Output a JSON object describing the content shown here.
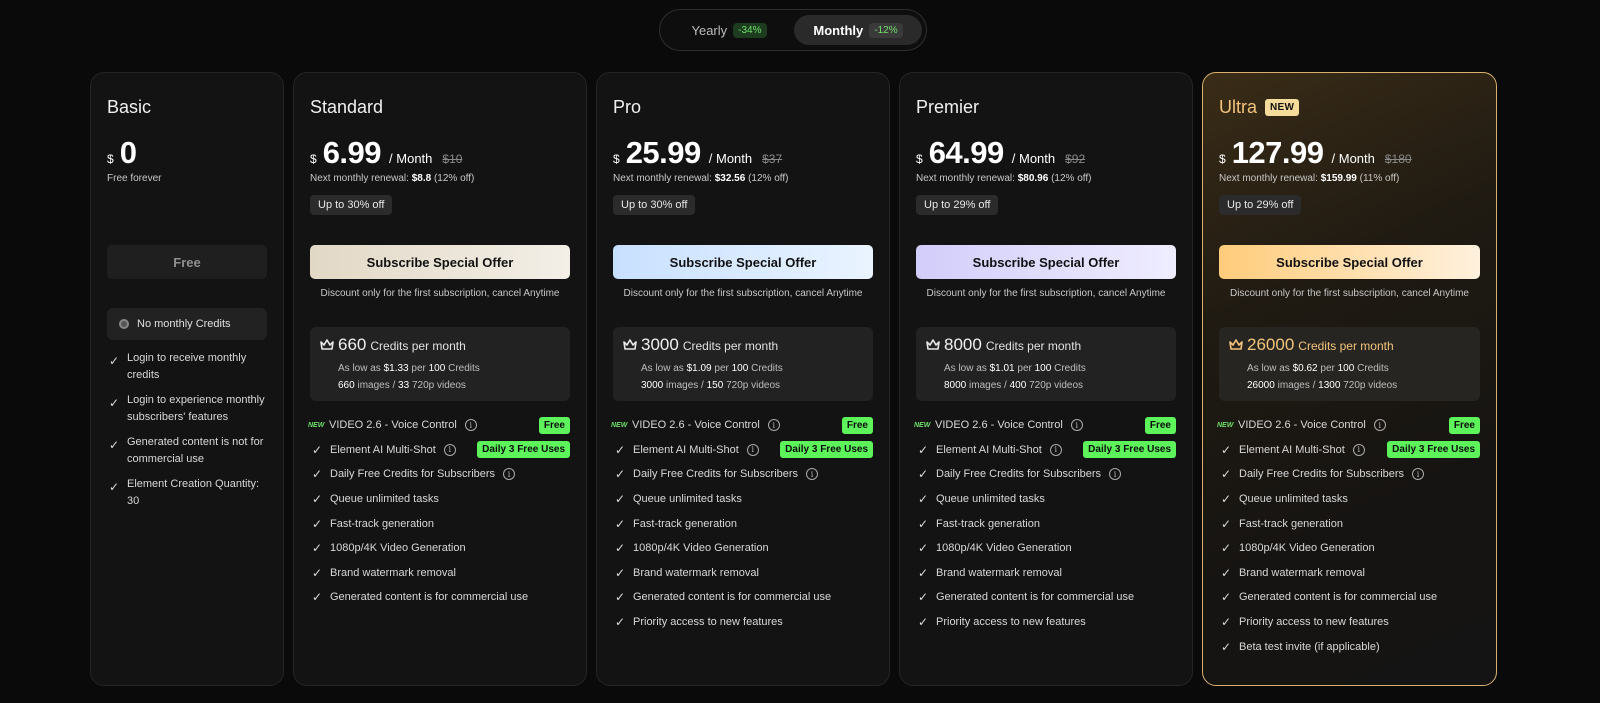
{
  "toggle": {
    "yearly": {
      "label": "Yearly",
      "discount": "-34%"
    },
    "monthly": {
      "label": "Monthly",
      "discount": "-12%"
    }
  },
  "basic": {
    "name": "Basic",
    "currency": "$",
    "amount": "0",
    "subtitle": "Free forever",
    "cta": "Free",
    "credits": "No monthly Credits",
    "features": [
      "Login to receive monthly credits",
      "Login to experience monthly subscribers' features",
      "Generated content is not for commercial use",
      "Element Creation Quantity: 30"
    ]
  },
  "common": {
    "per_month": "/ Month",
    "renewal_prefix": "Next monthly renewal:",
    "cta": "Subscribe Special Offer",
    "cta_note": "Discount only for the first subscription, cancel Anytime",
    "credits_suffix": "Credits per month",
    "as_low_as": "As low as",
    "per": "per",
    "per_credits_count": "100",
    "credits_word": "Credits",
    "images_word": "images /",
    "videos_word": "720p videos",
    "new_tag": "NEW",
    "video_feature": "VIDEO 2.6 - Voice Control",
    "video_badge": "Free",
    "multishot_feature": "Element AI Multi-Shot",
    "multishot_badge": "Daily 3 Free Uses",
    "daily_credits_feature": "Daily Free Credits for Subscribers"
  },
  "plans": [
    {
      "name": "Standard",
      "currency": "$",
      "amount": "6.99",
      "original": "$10",
      "renewal_amount": "$8.8",
      "renewal_off": "(12% off)",
      "off_badge": "Up to 30% off",
      "credits": "660",
      "price_per_100": "$1.33",
      "images": "660",
      "videos": "33",
      "features": [
        "Queue unlimited tasks",
        "Fast-track generation",
        "1080p/4K Video Generation",
        "Brand watermark removal",
        "Generated content is for commercial use"
      ]
    },
    {
      "name": "Pro",
      "currency": "$",
      "amount": "25.99",
      "original": "$37",
      "renewal_amount": "$32.56",
      "renewal_off": "(12% off)",
      "off_badge": "Up to 30% off",
      "credits": "3000",
      "price_per_100": "$1.09",
      "images": "3000",
      "videos": "150",
      "features": [
        "Queue unlimited tasks",
        "Fast-track generation",
        "1080p/4K Video Generation",
        "Brand watermark removal",
        "Generated content is for commercial use",
        "Priority access to new features"
      ]
    },
    {
      "name": "Premier",
      "currency": "$",
      "amount": "64.99",
      "original": "$92",
      "renewal_amount": "$80.96",
      "renewal_off": "(12% off)",
      "off_badge": "Up to 29% off",
      "credits": "8000",
      "price_per_100": "$1.01",
      "images": "8000",
      "videos": "400",
      "features": [
        "Queue unlimited tasks",
        "Fast-track generation",
        "1080p/4K Video Generation",
        "Brand watermark removal",
        "Generated content is for commercial use",
        "Priority access to new features"
      ]
    },
    {
      "name": "Ultra",
      "badge": "NEW",
      "currency": "$",
      "amount": "127.99",
      "original": "$180",
      "renewal_amount": "$159.99",
      "renewal_off": "(11% off)",
      "off_badge": "Up to 29% off",
      "credits": "26000",
      "price_per_100": "$0.62",
      "images": "26000",
      "videos": "1300",
      "features": [
        "Queue unlimited tasks",
        "Fast-track generation",
        "1080p/4K Video Generation",
        "Brand watermark removal",
        "Generated content is for commercial use",
        "Priority access to new features",
        "Beta test invite (if applicable)"
      ]
    }
  ],
  "colors": {
    "background": "#0a0a0a",
    "card": "#131313",
    "accent_green": "#5df35a",
    "ultra_gold": "#f3c47a"
  }
}
